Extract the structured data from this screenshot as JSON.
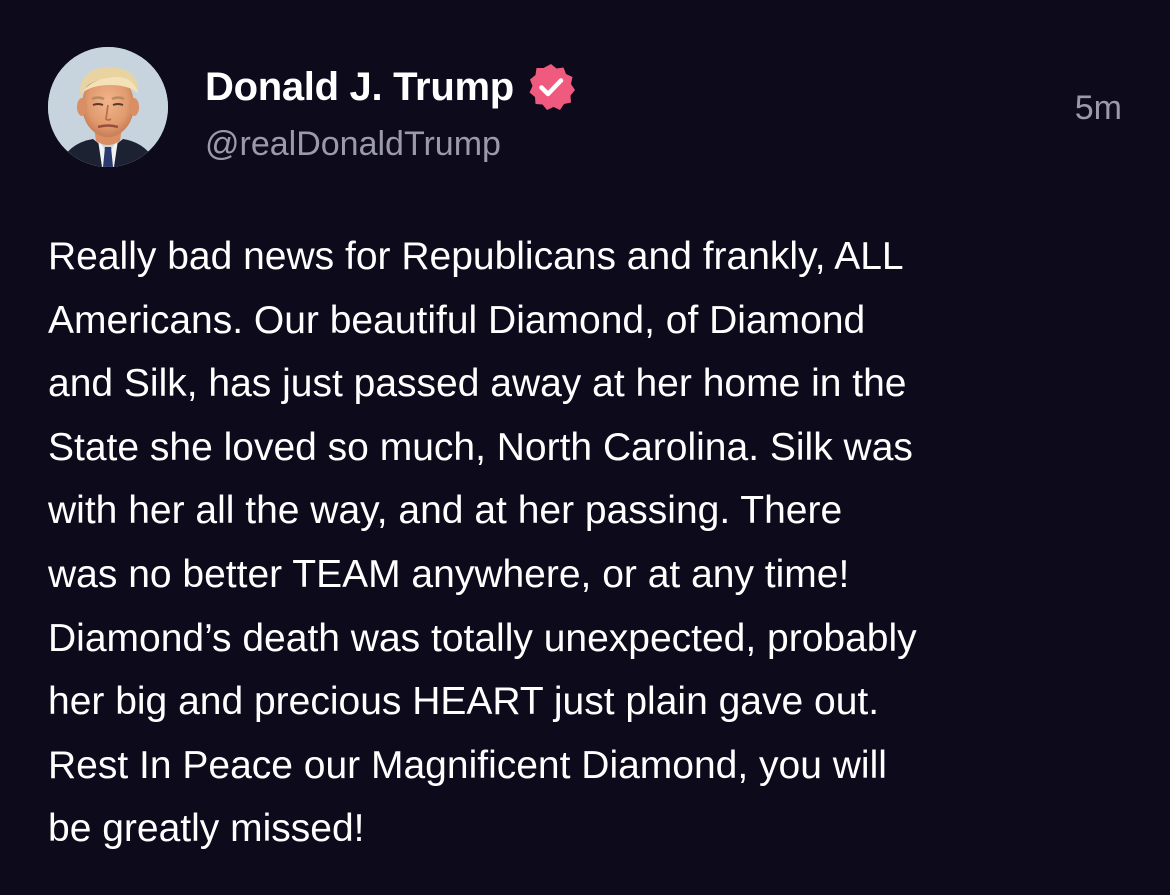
{
  "post": {
    "author": {
      "display_name": "Donald J. Trump",
      "handle": "@realDonaldTrump",
      "verified_icon": "verified-badge-icon",
      "avatar": "profile-photo"
    },
    "timestamp": "5m",
    "body_lines": [
      "Really bad news for Republicans and frankly, ALL",
      "Americans. Our beautiful Diamond, of Diamond",
      "and Silk, has just passed away at her home in the",
      "State she loved so much, North Carolina. Silk was",
      "with her all the way, and at her passing. There",
      "was no better TEAM anywhere, or at any time!",
      "Diamond’s death was totally unexpected, probably",
      "her big and precious HEART just plain gave out.",
      "Rest In Peace our Magnificent Diamond, you will",
      "be greatly missed!"
    ]
  },
  "colors": {
    "background": "#0c0a1b",
    "primary_text": "#ffffff",
    "secondary_text": "#9b9aab",
    "verified_badge": "#f05a7e"
  }
}
